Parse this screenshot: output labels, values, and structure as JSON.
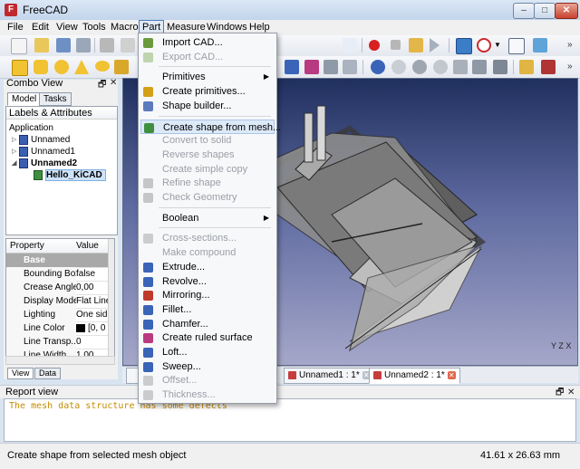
{
  "window": {
    "title": "FreeCAD",
    "min": "–",
    "max": "□",
    "close": "✕",
    "app_icon": "F"
  },
  "menubar": [
    "File",
    "Edit",
    "View",
    "Tools",
    "Macro",
    "Part",
    "Measure",
    "Windows",
    "Help"
  ],
  "menubar_active": "Part",
  "combo_view": {
    "title": "Combo View",
    "tabs": [
      "Model",
      "Tasks"
    ],
    "tree_header": "Labels & Attributes",
    "tree": {
      "root": "Application",
      "docs": [
        "Unnamed",
        "Unnamed1",
        "Unnamed2"
      ],
      "child": "Hello_KiCAD"
    },
    "property_header": {
      "name": "Property",
      "value": "Value"
    },
    "properties": [
      {
        "name": "Base",
        "value": "",
        "group": true
      },
      {
        "name": "Bounding Box",
        "value": "false"
      },
      {
        "name": "Crease Angle",
        "value": "0,00"
      },
      {
        "name": "Display Mode",
        "value": "Flat Lines"
      },
      {
        "name": "Lighting",
        "value": "One side"
      },
      {
        "name": "Line Color",
        "value": "[0, 0"
      },
      {
        "name": "Line Transp...",
        "value": "0"
      },
      {
        "name": "Line Width",
        "value": "1,00"
      }
    ],
    "bottom_tabs": [
      "View",
      "Data"
    ]
  },
  "part_menu": [
    {
      "label": "Import CAD...",
      "enabled": true,
      "icon": "import-cad-icon",
      "color": "#6a9a3c"
    },
    {
      "label": "Export CAD...",
      "enabled": false,
      "icon": "export-cad-icon",
      "color": "#6a9a3c"
    },
    {
      "separator": true
    },
    {
      "label": "Primitives",
      "enabled": true,
      "submenu": true
    },
    {
      "label": "Create primitives...",
      "enabled": true,
      "icon": "create-primitives-icon",
      "color": "#d4a017"
    },
    {
      "label": "Shape builder...",
      "enabled": true,
      "icon": "shape-builder-icon",
      "color": "#5b7bbd"
    },
    {
      "separator": true
    },
    {
      "label": "Create shape from mesh...",
      "enabled": true,
      "highlighted": true,
      "icon": "shape-from-mesh-icon",
      "color": "#3f8f3f"
    },
    {
      "label": "Convert to solid",
      "enabled": false
    },
    {
      "label": "Reverse shapes",
      "enabled": false
    },
    {
      "label": "Create simple copy",
      "enabled": false
    },
    {
      "label": "Refine shape",
      "enabled": false,
      "icon": "refine-shape-icon",
      "color": "#7a7a7a"
    },
    {
      "label": "Check Geometry",
      "enabled": false,
      "icon": "check-geometry-icon",
      "color": "#7a7a7a"
    },
    {
      "separator": true
    },
    {
      "label": "Boolean",
      "enabled": true,
      "submenu": true
    },
    {
      "separator": true
    },
    {
      "label": "Cross-sections...",
      "enabled": false,
      "icon": "cross-sections-icon",
      "color": "#8a8a8a"
    },
    {
      "label": "Make compound",
      "enabled": false
    },
    {
      "label": "Extrude...",
      "enabled": true,
      "icon": "extrude-icon",
      "color": "#3a64b8"
    },
    {
      "label": "Revolve...",
      "enabled": true,
      "icon": "revolve-icon",
      "color": "#3a64b8"
    },
    {
      "label": "Mirroring...",
      "enabled": true,
      "icon": "mirroring-icon",
      "color": "#c0392b"
    },
    {
      "label": "Fillet...",
      "enabled": true,
      "icon": "fillet-icon",
      "color": "#3a64b8"
    },
    {
      "label": "Chamfer...",
      "enabled": true,
      "icon": "chamfer-icon",
      "color": "#3a64b8"
    },
    {
      "label": "Create ruled surface",
      "enabled": true,
      "icon": "ruled-surface-icon",
      "color": "#b83a80"
    },
    {
      "label": "Loft...",
      "enabled": true,
      "icon": "loft-icon",
      "color": "#3a64b8"
    },
    {
      "label": "Sweep...",
      "enabled": true,
      "icon": "sweep-icon",
      "color": "#3a64b8"
    },
    {
      "label": "Offset...",
      "enabled": false,
      "icon": "offset-icon",
      "color": "#8a8a8a"
    },
    {
      "label": "Thickness...",
      "enabled": false,
      "icon": "thickness-icon",
      "color": "#8a8a8a"
    }
  ],
  "doc_tabs": [
    {
      "label": "Unnamed1 : 1*",
      "active": false
    },
    {
      "label": "Unnamed2 : 1*",
      "active": true
    }
  ],
  "view3d": {
    "axis_label": "Y Z X"
  },
  "report": {
    "title": "Report view",
    "message": "The mesh data structure has some defects"
  },
  "statusbar": {
    "message": "Create shape from selected mesh object",
    "dimensions": "41.61 x 26.63 mm"
  },
  "colors": {
    "report_text": "#c58b00",
    "highlight": "#dce9f7",
    "view_top": "#1f2f5e",
    "view_bottom": "#a5a7c9"
  }
}
